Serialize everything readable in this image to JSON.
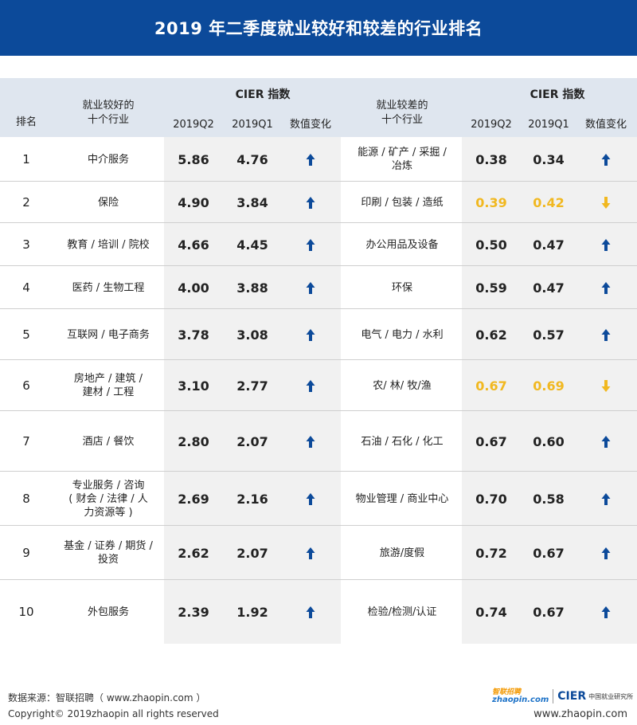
{
  "title": "2019 年二季度就业较好和较差的行业排名",
  "header": {
    "rank": "排名",
    "good_industry_line1": "就业较好的",
    "good_industry_line2": "十个行业",
    "cier_index_left": "CIER 指数",
    "q2_left": "2019Q2",
    "q1_left": "2019Q1",
    "change_left": "数值变化",
    "bad_industry_line1": "就业较差的",
    "bad_industry_line2": "十个行业",
    "cier_index_right": "CIER 指数",
    "q2_right": "2019Q2",
    "q1_right": "2019Q1",
    "change_right": "数值变化"
  },
  "colors": {
    "banner": "#0c4a9a",
    "header_bg": "#dfe6ef",
    "arrow_up": "#0c4a9a",
    "arrow_down_and_highlight": "#f1b820"
  },
  "rows": [
    {
      "rank": "1",
      "good_lines": [
        "中介服务"
      ],
      "good_q2": "5.86",
      "good_q1": "4.76",
      "good_change": "up",
      "bad_lines": [
        "能源 / 矿产 / 采掘 /",
        "冶炼"
      ],
      "bad_q2": "0.38",
      "bad_q1": "0.34",
      "bad_change": "up"
    },
    {
      "rank": "2",
      "good_lines": [
        "保险"
      ],
      "good_q2": "4.90",
      "good_q1": "3.84",
      "good_change": "up",
      "bad_lines": [
        "印刷 / 包装 / 造纸"
      ],
      "bad_q2": "0.39",
      "bad_q1": "0.42",
      "bad_change": "down"
    },
    {
      "rank": "3",
      "good_lines": [
        "教育 / 培训 / 院校"
      ],
      "good_q2": "4.66",
      "good_q1": "4.45",
      "good_change": "up",
      "bad_lines": [
        "办公用品及设备"
      ],
      "bad_q2": "0.50",
      "bad_q1": "0.47",
      "bad_change": "up"
    },
    {
      "rank": "4",
      "good_lines": [
        "医药 / 生物工程"
      ],
      "good_q2": "4.00",
      "good_q1": "3.88",
      "good_change": "up",
      "bad_lines": [
        "环保"
      ],
      "bad_q2": "0.59",
      "bad_q1": "0.47",
      "bad_change": "up"
    },
    {
      "rank": "5",
      "good_lines": [
        "互联网 / 电子商务"
      ],
      "good_q2": "3.78",
      "good_q1": "3.08",
      "good_change": "up",
      "bad_lines": [
        "电气 / 电力 / 水利"
      ],
      "bad_q2": "0.62",
      "bad_q1": "0.57",
      "bad_change": "up"
    },
    {
      "rank": "6",
      "good_lines": [
        "房地产 / 建筑 /",
        "建材 / 工程"
      ],
      "good_q2": "3.10",
      "good_q1": "2.77",
      "good_change": "up",
      "bad_lines": [
        "农/ 林/ 牧/渔"
      ],
      "bad_q2": "0.67",
      "bad_q1": "0.69",
      "bad_change": "down"
    },
    {
      "rank": "7",
      "good_lines": [
        "酒店 / 餐饮"
      ],
      "good_q2": "2.80",
      "good_q1": "2.07",
      "good_change": "up",
      "bad_lines": [
        "石油 / 石化 / 化工"
      ],
      "bad_q2": "0.67",
      "bad_q1": "0.60",
      "bad_change": "up"
    },
    {
      "rank": "8",
      "good_lines": [
        "专业服务 / 咨询",
        "( 财会 / 法律 / 人",
        "力资源等 )"
      ],
      "good_q2": "2.69",
      "good_q1": "2.16",
      "good_change": "up",
      "bad_lines": [
        "物业管理 / 商业中心"
      ],
      "bad_q2": "0.70",
      "bad_q1": "0.58",
      "bad_change": "up"
    },
    {
      "rank": "9",
      "good_lines": [
        "基金 / 证券 / 期货 /",
        "投资"
      ],
      "good_q2": "2.62",
      "good_q1": "2.07",
      "good_change": "up",
      "bad_lines": [
        "旅游/度假"
      ],
      "bad_q2": "0.72",
      "bad_q1": "0.67",
      "bad_change": "up"
    },
    {
      "rank": "10",
      "good_lines": [
        "外包服务"
      ],
      "good_q2": "2.39",
      "good_q1": "1.92",
      "good_change": "up",
      "bad_lines": [
        "检验/检测/认证"
      ],
      "bad_q2": "0.74",
      "bad_q1": "0.67",
      "bad_change": "up"
    }
  ],
  "footer": {
    "source": "数据来源：智联招聘（ www.zhaopin.com ）",
    "copyright": "Copyright© 2019zhaopin all rights reserved",
    "website": "www.zhaopin.com",
    "zhaopin_logo_top": "智联招聘",
    "zhaopin_logo_bottom": "zhaopin.com",
    "cier_logo": "CIER",
    "cier_cn": "中国就业研究所"
  }
}
